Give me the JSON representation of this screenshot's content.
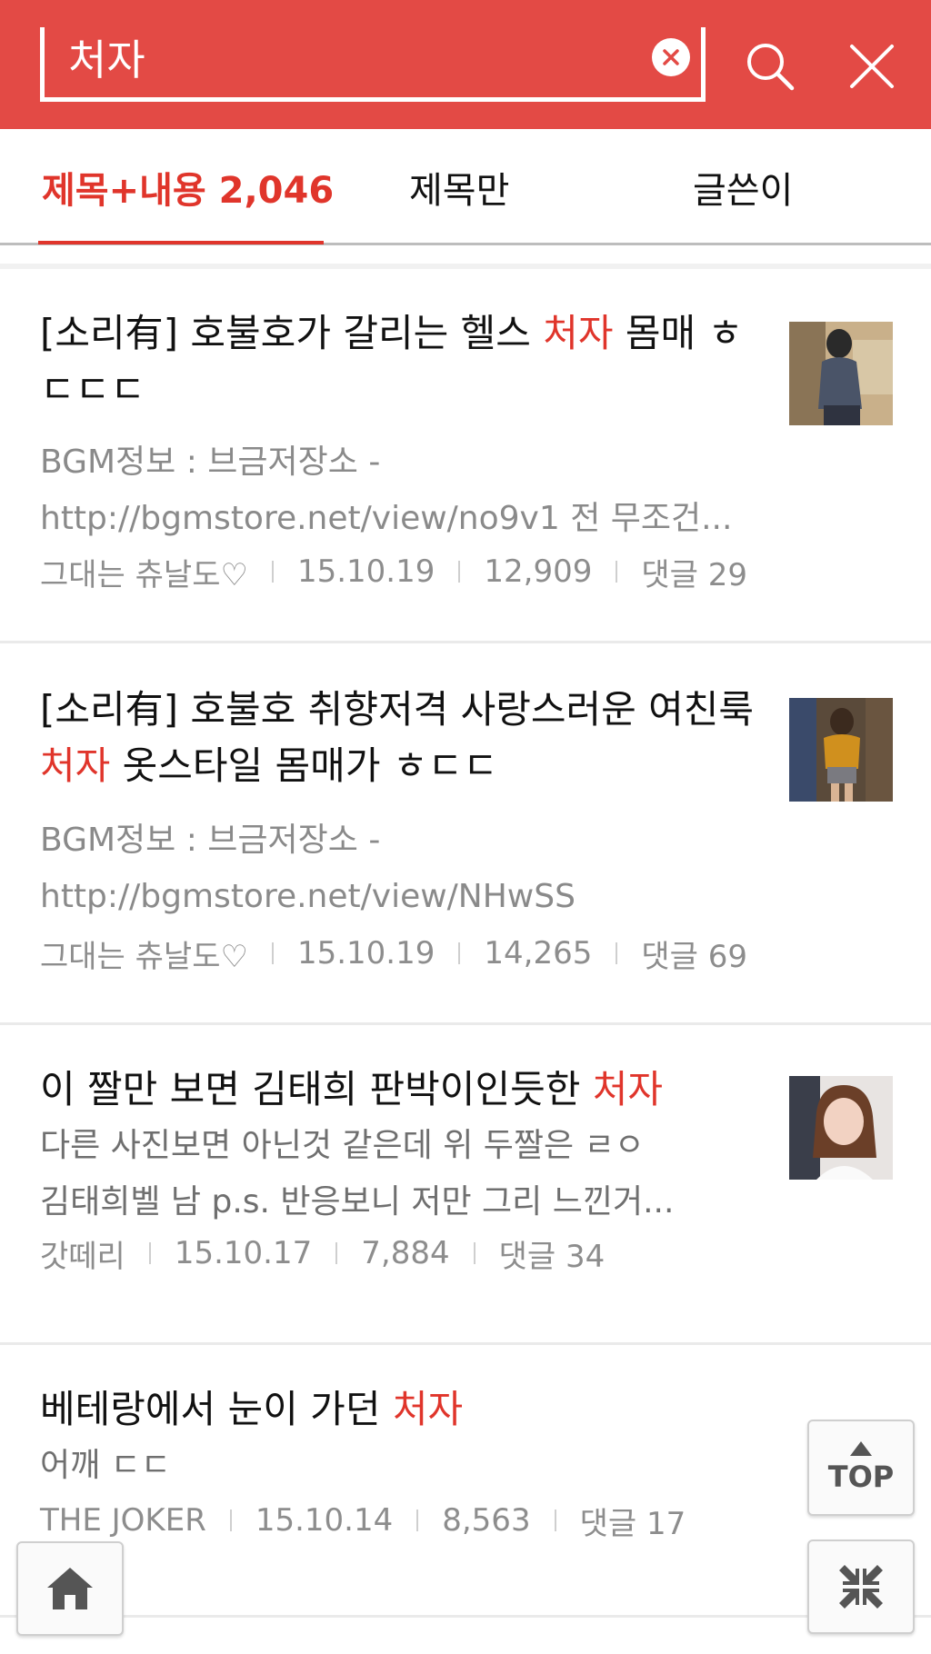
{
  "colors": {
    "brand": "#e34a45",
    "highlight": "#e0352b",
    "text": "#111111",
    "muted": "#8a8a8a"
  },
  "header": {
    "search_value": "처자",
    "clear_icon": "clear-circle-icon",
    "search_icon": "search-icon",
    "close_icon": "close-icon"
  },
  "tabs": [
    {
      "label": "제목+내용 2,046",
      "active": true
    },
    {
      "label": "제목만",
      "active": false
    },
    {
      "label": "글쓴이",
      "active": false
    }
  ],
  "items": [
    {
      "title_before": "[소리有] 호불호가 갈리는 헬스 ",
      "title_keyword": "처자",
      "title_after": " 몸매 ㅎㄷㄷㄷ",
      "body_lines": [
        "BGM정보 : 브금저장소 -",
        "http://bgmstore.net/view/no9v1 전 무조건..."
      ],
      "author": "그대는 츄날도♡",
      "date": "15.10.19",
      "views": "12,909",
      "comments": "댓글 29"
    },
    {
      "title_before": "[소리有] 호불호 취향저격 사랑스러운 여친룩 ",
      "title_keyword": "처자",
      "title_after": " 옷스타일 몸매가 ㅎㄷㄷ",
      "body_lines": [
        "BGM정보 : 브금저장소 -",
        "http://bgmstore.net/view/NHwSS"
      ],
      "author": "그대는 츄날도♡",
      "date": "15.10.19",
      "views": "14,265",
      "comments": "댓글 69"
    },
    {
      "title_before": "이 짤만 보면 김태희 판박이인듯한 ",
      "title_keyword": "처자",
      "title_after": "",
      "body_lines": [
        "다른 사진보면 아닌것 같은데 위 두짤은 ㄹㅇ",
        "김태희벨 남 p.s. 반응보니 저만 그리 느낀거..."
      ],
      "author": "갓떼리",
      "date": "15.10.17",
      "views": "7,884",
      "comments": "댓글 34"
    },
    {
      "title_before": "베테랑에서 눈이 가던 ",
      "title_keyword": "처자",
      "title_after": "",
      "body_lines": [
        "어깨 ㄷㄷ"
      ],
      "author": "THE JOKER",
      "date": "15.10.14",
      "views": "8,563",
      "comments": "댓글 17"
    }
  ],
  "floating": {
    "top_label": "TOP",
    "home_icon": "home-icon",
    "collapse_icon": "collapse-arrows-icon"
  }
}
